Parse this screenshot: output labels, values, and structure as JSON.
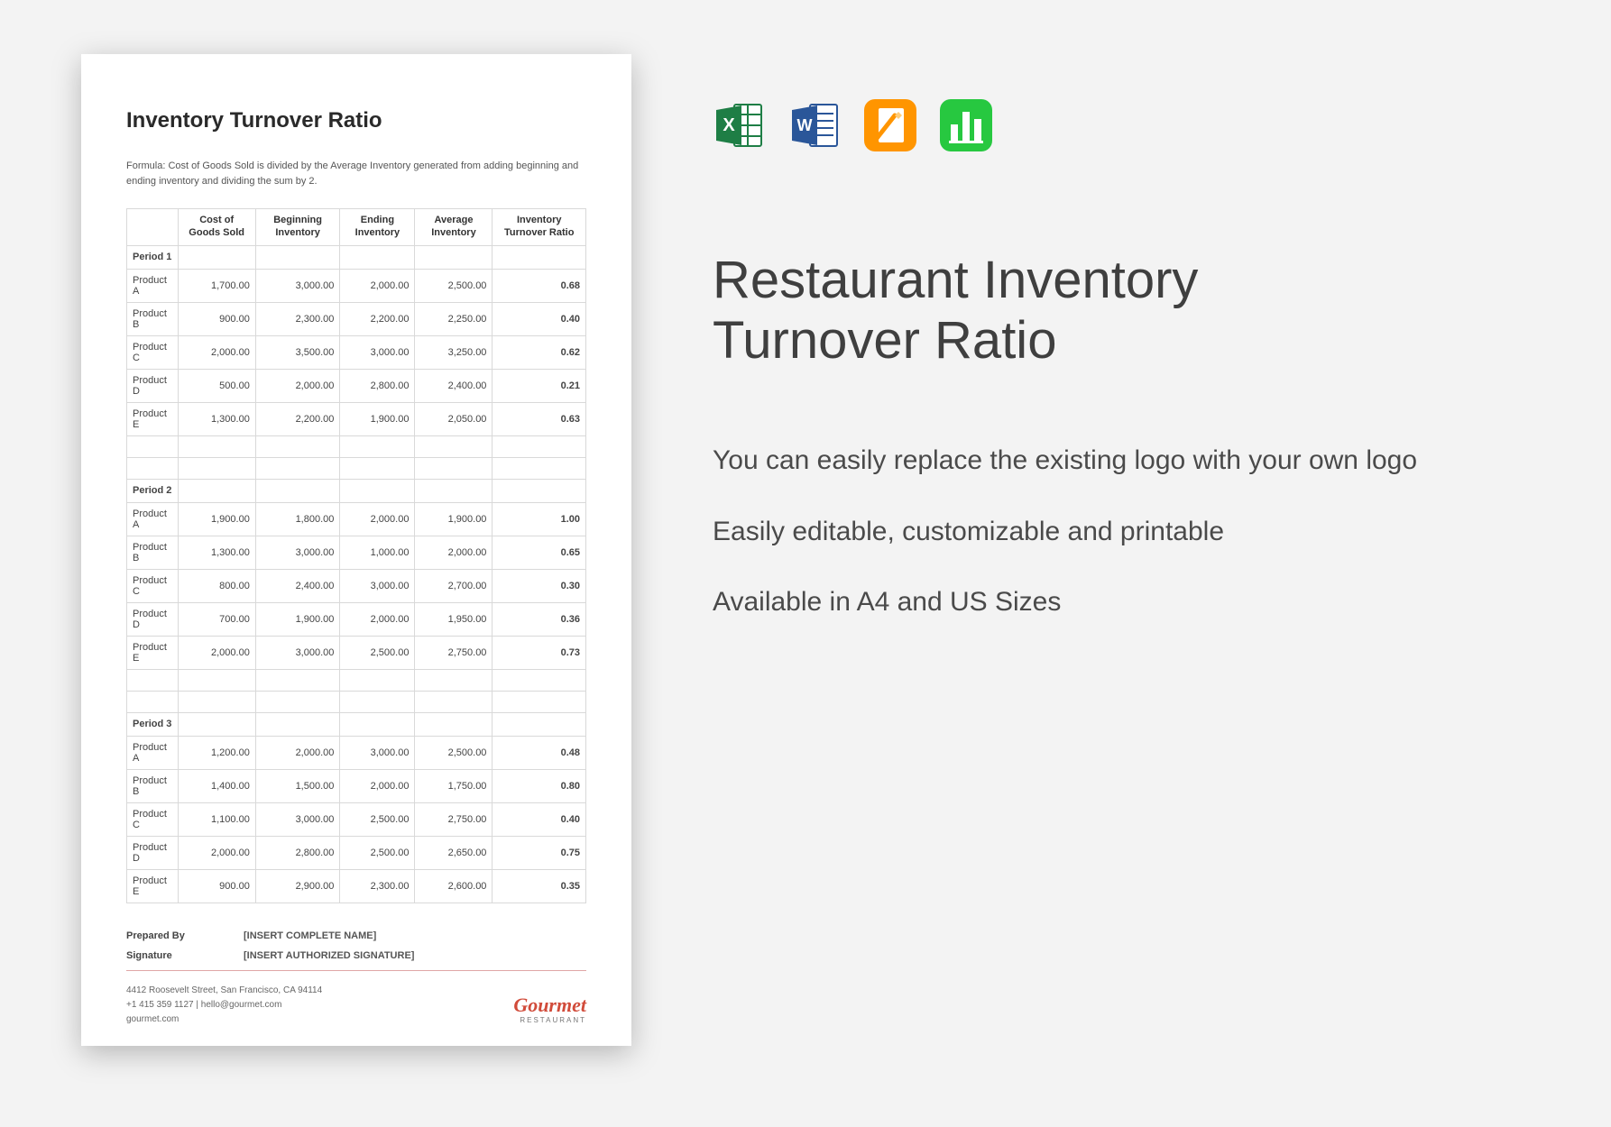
{
  "doc": {
    "title": "Inventory Turnover Ratio",
    "formula": "Formula: Cost of Goods Sold is divided by the Average Inventory generated from adding beginning and ending inventory and dividing the sum by 2.",
    "columns": [
      "",
      "Cost of Goods Sold",
      "Beginning Inventory",
      "Ending Inventory",
      "Average Inventory",
      "Inventory Turnover Ratio"
    ],
    "periods": [
      {
        "label": "Period 1",
        "rows": [
          {
            "name": "Product A",
            "cogs": "1,700.00",
            "beg": "3,000.00",
            "end": "2,000.00",
            "avg": "2,500.00",
            "ratio": "0.68"
          },
          {
            "name": "Product B",
            "cogs": "900.00",
            "beg": "2,300.00",
            "end": "2,200.00",
            "avg": "2,250.00",
            "ratio": "0.40"
          },
          {
            "name": "Product C",
            "cogs": "2,000.00",
            "beg": "3,500.00",
            "end": "3,000.00",
            "avg": "3,250.00",
            "ratio": "0.62"
          },
          {
            "name": "Product D",
            "cogs": "500.00",
            "beg": "2,000.00",
            "end": "2,800.00",
            "avg": "2,400.00",
            "ratio": "0.21"
          },
          {
            "name": "Product E",
            "cogs": "1,300.00",
            "beg": "2,200.00",
            "end": "1,900.00",
            "avg": "2,050.00",
            "ratio": "0.63"
          }
        ]
      },
      {
        "label": "Period 2",
        "rows": [
          {
            "name": "Product A",
            "cogs": "1,900.00",
            "beg": "1,800.00",
            "end": "2,000.00",
            "avg": "1,900.00",
            "ratio": "1.00"
          },
          {
            "name": "Product B",
            "cogs": "1,300.00",
            "beg": "3,000.00",
            "end": "1,000.00",
            "avg": "2,000.00",
            "ratio": "0.65"
          },
          {
            "name": "Product C",
            "cogs": "800.00",
            "beg": "2,400.00",
            "end": "3,000.00",
            "avg": "2,700.00",
            "ratio": "0.30"
          },
          {
            "name": "Product D",
            "cogs": "700.00",
            "beg": "1,900.00",
            "end": "2,000.00",
            "avg": "1,950.00",
            "ratio": "0.36"
          },
          {
            "name": "Product E",
            "cogs": "2,000.00",
            "beg": "3,000.00",
            "end": "2,500.00",
            "avg": "2,750.00",
            "ratio": "0.73"
          }
        ]
      },
      {
        "label": "Period 3",
        "rows": [
          {
            "name": "Product A",
            "cogs": "1,200.00",
            "beg": "2,000.00",
            "end": "3,000.00",
            "avg": "2,500.00",
            "ratio": "0.48"
          },
          {
            "name": "Product B",
            "cogs": "1,400.00",
            "beg": "1,500.00",
            "end": "2,000.00",
            "avg": "1,750.00",
            "ratio": "0.80"
          },
          {
            "name": "Product C",
            "cogs": "1,100.00",
            "beg": "3,000.00",
            "end": "2,500.00",
            "avg": "2,750.00",
            "ratio": "0.40"
          },
          {
            "name": "Product D",
            "cogs": "2,000.00",
            "beg": "2,800.00",
            "end": "2,500.00",
            "avg": "2,650.00",
            "ratio": "0.75"
          },
          {
            "name": "Product E",
            "cogs": "900.00",
            "beg": "2,900.00",
            "end": "2,300.00",
            "avg": "2,600.00",
            "ratio": "0.35"
          }
        ]
      }
    ],
    "meta": {
      "prepared_label": "Prepared By",
      "prepared_value": "[INSERT COMPLETE NAME]",
      "signature_label": "Signature",
      "signature_value": "[INSERT AUTHORIZED SIGNATURE]"
    },
    "footer": {
      "address": "4412 Roosevelt Street, San Francisco, CA 94114",
      "contact": "+1 415 359 1127 | hello@gourmet.com",
      "site": "gourmet.com",
      "brand_name": "Gourmet",
      "brand_sub": "RESTAURANT"
    }
  },
  "panel": {
    "icons": [
      "excel-icon",
      "word-icon",
      "pages-icon",
      "numbers-icon"
    ],
    "title_line1": "Restaurant Inventory",
    "title_line2": "Turnover Ratio",
    "features": [
      "You can easily replace the existing logo with your own logo",
      "Easily editable, customizable and printable",
      "Available in A4 and US Sizes"
    ]
  }
}
